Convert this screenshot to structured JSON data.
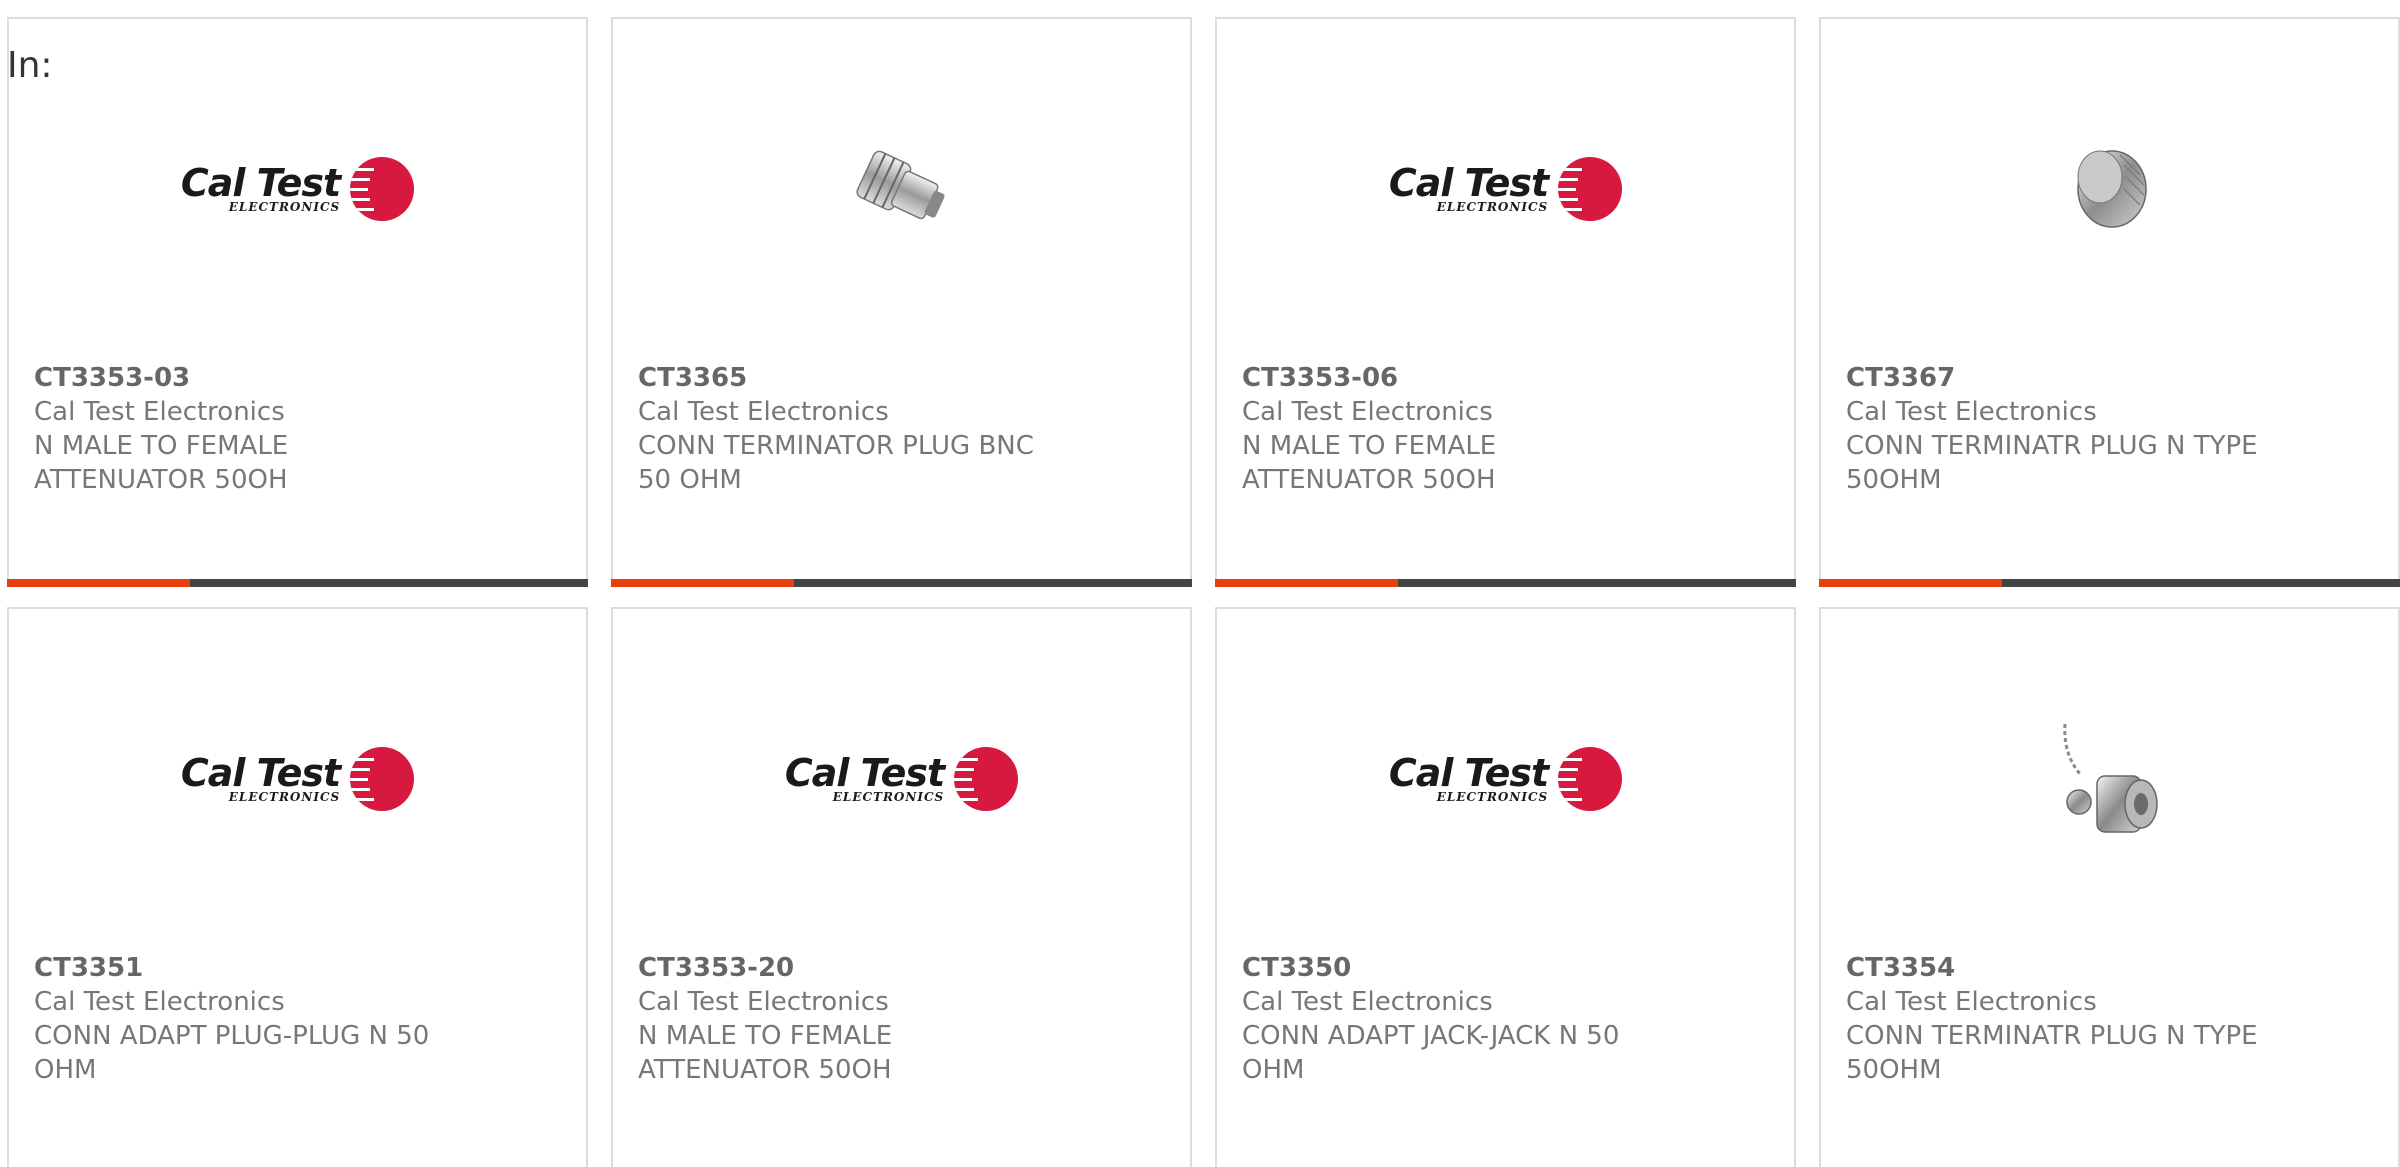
{
  "filter_label": "In:",
  "logo": {
    "brand": "Cal Test",
    "sub": "ELECTRONICS",
    "color": "#d7193f"
  },
  "accent_color": "#e8400c",
  "products": [
    {
      "part": "CT3353-03",
      "mfr": "Cal Test Electronics",
      "desc1": "N MALE TO FEMALE",
      "desc2": "ATTENUATOR 50OH",
      "image": "logo"
    },
    {
      "part": "CT3365",
      "mfr": "Cal Test Electronics",
      "desc1": "CONN TERMINATOR PLUG BNC",
      "desc2": "50 OHM",
      "image": "bnc-terminator-photo"
    },
    {
      "part": "CT3353-06",
      "mfr": "Cal Test Electronics",
      "desc1": "N MALE TO FEMALE",
      "desc2": "ATTENUATOR 50OH",
      "image": "logo"
    },
    {
      "part": "CT3367",
      "mfr": "Cal Test Electronics",
      "desc1": "CONN TERMINATR PLUG N TYPE",
      "desc2": "50OHM",
      "image": "n-terminator-photo"
    },
    {
      "part": "CT3351",
      "mfr": "Cal Test Electronics",
      "desc1": "CONN ADAPT PLUG-PLUG N 50",
      "desc2": "OHM",
      "image": "logo"
    },
    {
      "part": "CT3353-20",
      "mfr": "Cal Test Electronics",
      "desc1": "N MALE TO FEMALE",
      "desc2": "ATTENUATOR 50OH",
      "image": "logo"
    },
    {
      "part": "CT3350",
      "mfr": "Cal Test Electronics",
      "desc1": "CONN ADAPT JACK-JACK N 50",
      "desc2": "OHM",
      "image": "logo"
    },
    {
      "part": "CT3354",
      "mfr": "Cal Test Electronics",
      "desc1": "CONN TERMINATR PLUG N TYPE",
      "desc2": "50OHM",
      "image": "n-terminator-chain-photo"
    }
  ]
}
